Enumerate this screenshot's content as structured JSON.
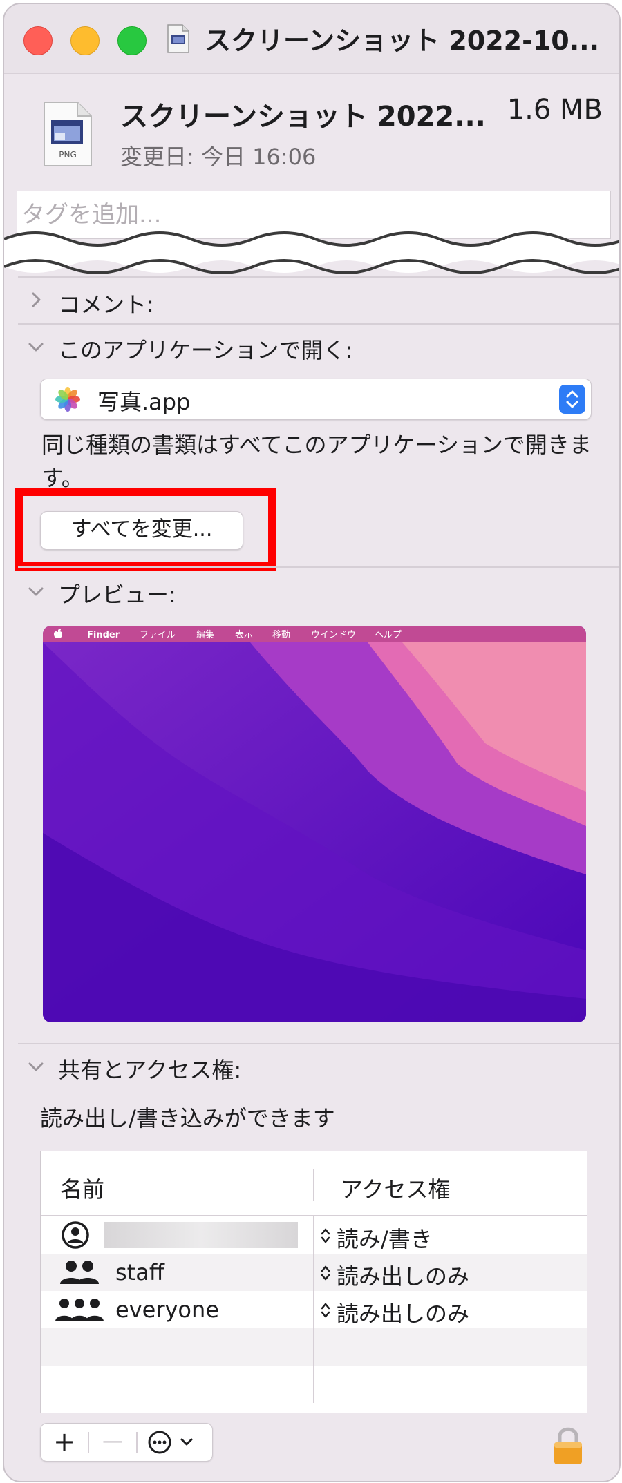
{
  "window": {
    "title": "スクリーンショット 2022-10..."
  },
  "header": {
    "file_name": "スクリーンショット 2022...",
    "file_size": "1.6 MB",
    "modified": "変更日: 今日 16:06",
    "file_icon_label": "PNG",
    "tags_placeholder": "タグを追加..."
  },
  "sections": {
    "comments": "コメント:",
    "open_with": "このアプリケーションで開く:",
    "preview": "プレビュー:",
    "sharing": "共有とアクセス権:"
  },
  "open_with": {
    "selected_app": "写真.app",
    "description": "同じ種類の書類はすべてこのアプリケーションで開きます。",
    "change_all_label": "すべてを変更..."
  },
  "preview_menubar": [
    "Finder",
    "ファイル",
    "編集",
    "表示",
    "移動",
    "ウインドウ",
    "ヘルプ"
  ],
  "sharing": {
    "status": "読み出し/書き込みができます",
    "columns": [
      "名前",
      "アクセス権"
    ],
    "rows": [
      {
        "name": "",
        "permission": "読み/書き",
        "icon": "user-icon"
      },
      {
        "name": "staff",
        "permission": "読み出しのみ",
        "icon": "group-icon"
      },
      {
        "name": "everyone",
        "permission": "読み出しのみ",
        "icon": "everyone-icon"
      }
    ]
  },
  "toolbar": {
    "add_label": "+",
    "remove_label": "—"
  },
  "colors": {
    "highlight": "#ff0000",
    "accent": "#2e7cf6",
    "window_bg": "#ede7ed"
  }
}
